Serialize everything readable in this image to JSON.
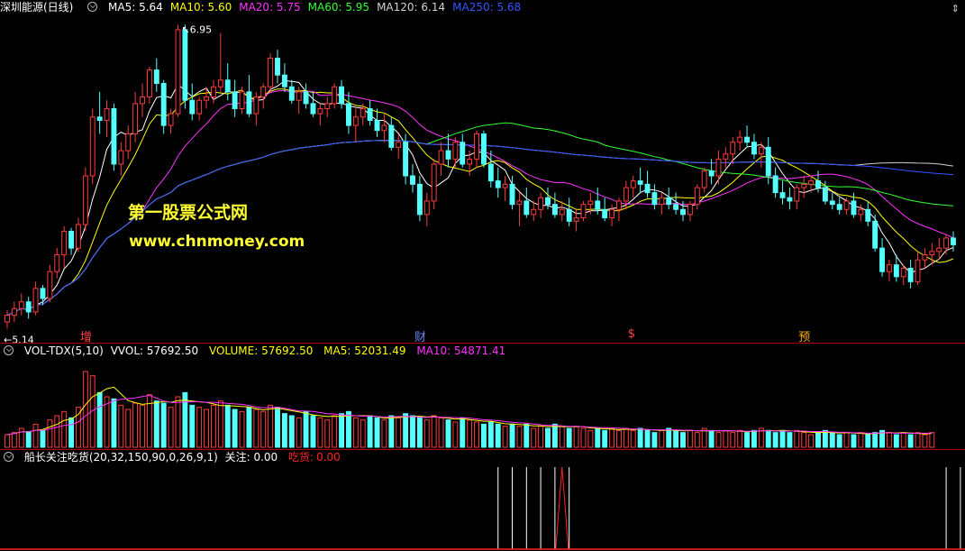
{
  "header": {
    "stock_name": "深圳能源(日线)",
    "ma": [
      {
        "label": "MA5: 5.64",
        "color": "#ffffff"
      },
      {
        "label": "MA10: 5.60",
        "color": "#ffff00"
      },
      {
        "label": "MA20: 5.75",
        "color": "#ff33ff"
      },
      {
        "label": "MA60: 5.95",
        "color": "#33ff33"
      },
      {
        "label": "MA120: 6.14",
        "color": "#d0d0d0"
      },
      {
        "label": "MA250: 5.68",
        "color": "#3355ff"
      }
    ],
    "corner_icon": "up-down-arrows-icon"
  },
  "price_panel": {
    "high_label": "6.95",
    "low_label": "5.14",
    "watermark_cn": "第一股票公式网",
    "watermark_url": "www.chnmoney.com",
    "event_markers": [
      {
        "label": "增",
        "color": "#ff4444",
        "index": 11
      },
      {
        "label": "财",
        "color": "#6688ff",
        "index": 58
      },
      {
        "label": "$",
        "color": "#ff4444",
        "index": 88
      },
      {
        "label": "预",
        "color": "#ffaa00",
        "index": 112
      }
    ]
  },
  "volume_panel": {
    "title": "VOL-TDX(5,10)",
    "vvol": "VVOL: 57692.50",
    "volume": "VOLUME: 57692.50",
    "ma5": "MA5: 52031.49",
    "ma10": "MA10: 54871.41"
  },
  "indicator_panel": {
    "title": "船长关注吃货(20,32,150,90,0,26,9,1)",
    "guanzhu": "关注: 0.00",
    "chihuo_label": "吃货:",
    "chihuo_value": "0.00"
  },
  "chart_data": {
    "type": "candlestick",
    "price_range": [
      5.1,
      7.0
    ],
    "candles_ohlc": [
      [
        5.18,
        5.25,
        5.14,
        5.22
      ],
      [
        5.22,
        5.3,
        5.18,
        5.26
      ],
      [
        5.26,
        5.35,
        5.22,
        5.3
      ],
      [
        5.3,
        5.33,
        5.2,
        5.24
      ],
      [
        5.24,
        5.42,
        5.22,
        5.38
      ],
      [
        5.38,
        5.4,
        5.28,
        5.32
      ],
      [
        5.32,
        5.52,
        5.3,
        5.48
      ],
      [
        5.48,
        5.62,
        5.44,
        5.58
      ],
      [
        5.58,
        5.75,
        5.5,
        5.72
      ],
      [
        5.72,
        5.74,
        5.58,
        5.62
      ],
      [
        5.62,
        5.8,
        5.6,
        5.76
      ],
      [
        5.76,
        6.1,
        5.72,
        6.05
      ],
      [
        6.05,
        6.45,
        6.0,
        6.4
      ],
      [
        6.4,
        6.55,
        6.3,
        6.38
      ],
      [
        6.38,
        6.5,
        6.28,
        6.45
      ],
      [
        6.45,
        6.48,
        6.08,
        6.12
      ],
      [
        6.12,
        6.25,
        6.05,
        6.2
      ],
      [
        6.2,
        6.35,
        6.15,
        6.3
      ],
      [
        6.3,
        6.55,
        6.25,
        6.48
      ],
      [
        6.48,
        6.6,
        6.4,
        6.52
      ],
      [
        6.52,
        6.7,
        6.48,
        6.68
      ],
      [
        6.68,
        6.75,
        6.55,
        6.6
      ],
      [
        6.6,
        6.62,
        6.3,
        6.35
      ],
      [
        6.35,
        6.45,
        6.3,
        6.42
      ],
      [
        6.42,
        6.95,
        6.4,
        6.92
      ],
      [
        6.92,
        6.95,
        6.45,
        6.5
      ],
      [
        6.5,
        6.6,
        6.38,
        6.42
      ],
      [
        6.42,
        6.52,
        6.38,
        6.5
      ],
      [
        6.5,
        6.58,
        6.45,
        6.52
      ],
      [
        6.52,
        6.62,
        6.48,
        6.58
      ],
      [
        6.58,
        6.9,
        6.55,
        6.62
      ],
      [
        6.62,
        6.72,
        6.5,
        6.55
      ],
      [
        6.55,
        6.62,
        6.4,
        6.45
      ],
      [
        6.45,
        6.58,
        6.42,
        6.55
      ],
      [
        6.55,
        6.65,
        6.4,
        6.42
      ],
      [
        6.42,
        6.55,
        6.35,
        6.52
      ],
      [
        6.52,
        6.6,
        6.45,
        6.58
      ],
      [
        6.58,
        6.78,
        6.55,
        6.75
      ],
      [
        6.75,
        6.8,
        6.6,
        6.65
      ],
      [
        6.65,
        6.72,
        6.55,
        6.58
      ],
      [
        6.58,
        6.62,
        6.48,
        6.5
      ],
      [
        6.5,
        6.58,
        6.42,
        6.55
      ],
      [
        6.55,
        6.6,
        6.45,
        6.48
      ],
      [
        6.48,
        6.55,
        6.4,
        6.42
      ],
      [
        6.42,
        6.48,
        6.35,
        6.45
      ],
      [
        6.45,
        6.52,
        6.4,
        6.48
      ],
      [
        6.48,
        6.6,
        6.45,
        6.58
      ],
      [
        6.58,
        6.62,
        6.45,
        6.48
      ],
      [
        6.48,
        6.55,
        6.3,
        6.35
      ],
      [
        6.35,
        6.45,
        6.25,
        6.4
      ],
      [
        6.4,
        6.48,
        6.35,
        6.45
      ],
      [
        6.45,
        6.5,
        6.35,
        6.38
      ],
      [
        6.38,
        6.45,
        6.28,
        6.32
      ],
      [
        6.32,
        6.42,
        6.25,
        6.35
      ],
      [
        6.35,
        6.4,
        6.2,
        6.22
      ],
      [
        6.22,
        6.3,
        6.15,
        6.25
      ],
      [
        6.25,
        6.3,
        6.0,
        6.05
      ],
      [
        6.05,
        6.12,
        5.95,
        6.0
      ],
      [
        6.0,
        6.05,
        5.78,
        5.82
      ],
      [
        5.82,
        5.95,
        5.75,
        5.9
      ],
      [
        5.9,
        6.15,
        5.85,
        6.12
      ],
      [
        6.12,
        6.25,
        6.05,
        6.2
      ],
      [
        6.2,
        6.3,
        6.1,
        6.15
      ],
      [
        6.15,
        6.28,
        6.1,
        6.25
      ],
      [
        6.25,
        6.3,
        6.1,
        6.12
      ],
      [
        6.12,
        6.2,
        6.05,
        6.15
      ],
      [
        6.15,
        6.32,
        6.1,
        6.3
      ],
      [
        6.3,
        6.32,
        6.1,
        6.12
      ],
      [
        6.12,
        6.2,
        5.98,
        6.02
      ],
      [
        6.02,
        6.1,
        5.92,
        5.98
      ],
      [
        5.98,
        6.05,
        5.9,
        6.0
      ],
      [
        6.0,
        6.05,
        5.85,
        5.88
      ],
      [
        5.88,
        5.95,
        5.75,
        5.9
      ],
      [
        5.9,
        5.98,
        5.8,
        5.82
      ],
      [
        5.82,
        5.9,
        5.78,
        5.85
      ],
      [
        5.85,
        5.95,
        5.8,
        5.92
      ],
      [
        5.92,
        5.98,
        5.85,
        5.88
      ],
      [
        5.88,
        5.95,
        5.8,
        5.82
      ],
      [
        5.82,
        5.9,
        5.78,
        5.85
      ],
      [
        5.85,
        5.92,
        5.75,
        5.78
      ],
      [
        5.78,
        5.85,
        5.72,
        5.8
      ],
      [
        5.8,
        5.9,
        5.78,
        5.88
      ],
      [
        5.88,
        5.95,
        5.82,
        5.9
      ],
      [
        5.9,
        5.98,
        5.82,
        5.85
      ],
      [
        5.85,
        5.92,
        5.78,
        5.8
      ],
      [
        5.8,
        5.88,
        5.75,
        5.85
      ],
      [
        5.85,
        5.92,
        5.78,
        5.9
      ],
      [
        5.9,
        6.02,
        5.85,
        5.98
      ],
      [
        5.98,
        6.05,
        5.92,
        6.02
      ],
      [
        6.02,
        6.1,
        5.95,
        6.0
      ],
      [
        6.0,
        6.08,
        5.92,
        5.95
      ],
      [
        5.95,
        6.0,
        5.85,
        5.88
      ],
      [
        5.88,
        5.95,
        5.82,
        5.92
      ],
      [
        5.92,
        5.98,
        5.85,
        5.88
      ],
      [
        5.88,
        5.95,
        5.82,
        5.85
      ],
      [
        5.85,
        5.9,
        5.78,
        5.82
      ],
      [
        5.82,
        5.9,
        5.78,
        5.88
      ],
      [
        5.88,
        6.0,
        5.85,
        5.98
      ],
      [
        5.98,
        6.1,
        5.95,
        6.08
      ],
      [
        6.08,
        6.15,
        6.0,
        6.05
      ],
      [
        6.05,
        6.2,
        6.0,
        6.15
      ],
      [
        6.15,
        6.22,
        6.1,
        6.18
      ],
      [
        6.18,
        6.28,
        6.12,
        6.25
      ],
      [
        6.25,
        6.32,
        6.2,
        6.28
      ],
      [
        6.28,
        6.35,
        6.22,
        6.25
      ],
      [
        6.25,
        6.3,
        6.15,
        6.18
      ],
      [
        6.18,
        6.25,
        6.1,
        6.22
      ],
      [
        6.22,
        6.28,
        6.0,
        6.05
      ],
      [
        6.05,
        6.1,
        5.92,
        5.95
      ],
      [
        5.95,
        6.02,
        5.88,
        5.92
      ],
      [
        5.92,
        5.98,
        5.85,
        5.9
      ],
      [
        5.9,
        6.0,
        5.85,
        5.98
      ],
      [
        5.98,
        6.05,
        5.92,
        6.0
      ],
      [
        6.0,
        6.05,
        5.95,
        6.02
      ],
      [
        6.02,
        6.08,
        5.95,
        5.98
      ],
      [
        5.98,
        6.02,
        5.88,
        5.9
      ],
      [
        5.9,
        5.95,
        5.85,
        5.88
      ],
      [
        5.88,
        5.92,
        5.82,
        5.85
      ],
      [
        5.85,
        5.92,
        5.82,
        5.9
      ],
      [
        5.9,
        5.95,
        5.8,
        5.82
      ],
      [
        5.82,
        5.88,
        5.78,
        5.85
      ],
      [
        5.85,
        5.9,
        5.75,
        5.78
      ],
      [
        5.78,
        5.82,
        5.6,
        5.62
      ],
      [
        5.62,
        5.68,
        5.45,
        5.48
      ],
      [
        5.48,
        5.55,
        5.42,
        5.52
      ],
      [
        5.52,
        5.58,
        5.42,
        5.45
      ],
      [
        5.45,
        5.52,
        5.4,
        5.5
      ],
      [
        5.5,
        5.55,
        5.38,
        5.42
      ],
      [
        5.42,
        5.6,
        5.4,
        5.55
      ],
      [
        5.55,
        5.62,
        5.5,
        5.58
      ],
      [
        5.58,
        5.65,
        5.52,
        5.6
      ],
      [
        5.6,
        5.68,
        5.55,
        5.62
      ],
      [
        5.62,
        5.7,
        5.58,
        5.68
      ],
      [
        5.68,
        5.72,
        5.6,
        5.64
      ]
    ],
    "volumes": [
      12,
      14,
      18,
      15,
      22,
      16,
      26,
      30,
      34,
      28,
      38,
      72,
      68,
      52,
      48,
      46,
      40,
      36,
      42,
      40,
      50,
      44,
      42,
      38,
      48,
      52,
      40,
      38,
      36,
      40,
      44,
      40,
      36,
      34,
      38,
      36,
      34,
      40,
      38,
      32,
      30,
      28,
      34,
      30,
      28,
      26,
      30,
      32,
      34,
      28,
      26,
      30,
      28,
      26,
      30,
      28,
      32,
      30,
      28,
      26,
      30,
      28,
      26,
      24,
      28,
      26,
      24,
      22,
      24,
      22,
      20,
      22,
      20,
      22,
      18,
      20,
      18,
      22,
      20,
      18,
      20,
      18,
      16,
      18,
      16,
      18,
      16,
      18,
      16,
      18,
      16,
      14,
      16,
      18,
      16,
      14,
      16,
      14,
      18,
      16,
      14,
      16,
      14,
      16,
      14,
      16,
      18,
      16,
      14,
      16,
      14,
      16,
      14,
      12,
      14,
      16,
      14,
      12,
      14,
      12,
      14,
      12,
      14,
      16,
      14,
      12,
      14,
      12,
      14,
      12,
      14
    ],
    "chihuo_signal_indices": [
      69,
      71,
      73,
      75,
      77,
      79,
      132,
      134,
      136,
      138,
      140,
      142
    ],
    "peak_index": 78,
    "series_names": [
      "MA5",
      "MA10",
      "MA20",
      "MA60",
      "MA120",
      "MA250"
    ]
  }
}
